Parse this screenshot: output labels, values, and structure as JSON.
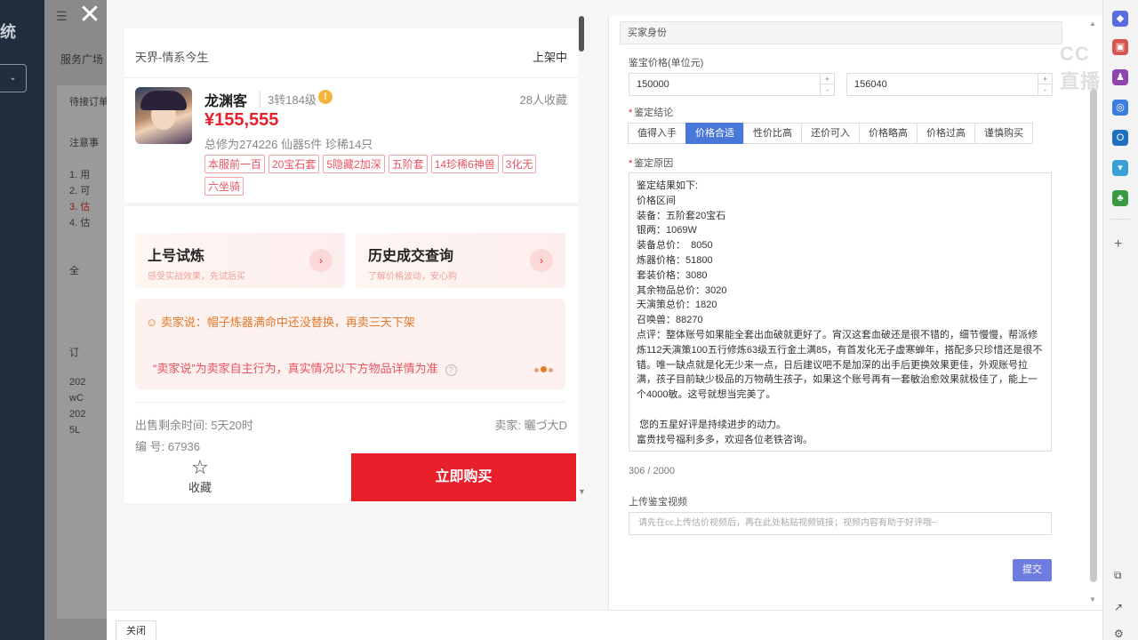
{
  "background": {
    "brand_fragment": "统",
    "select_arrow": "⌄",
    "nav_title": "服务广场",
    "card_lines": [
      "待接订单",
      "注意事",
      "1. 用",
      "2. 可",
      "3. 估",
      "4. 估",
      "全",
      "订",
      "202",
      "wC",
      "202",
      "5L"
    ]
  },
  "preview": {
    "server": "天界-情系今生",
    "status": "上架中",
    "role_name": "龙渊客",
    "role_level": "3转184级",
    "favorites": "28人收藏",
    "price": "¥155,555",
    "stats": "总修为274226  仙器5件  珍稀14只",
    "tags": [
      "本服前一百",
      "20宝石套",
      "5隐藏2加深",
      "五阶套",
      "14珍稀6神兽",
      "3化无",
      "六坐骑"
    ],
    "card1": {
      "title": "上号试炼",
      "sub": "感受实战效果，先试后买"
    },
    "card2": {
      "title": "历史成交查询",
      "sub": "了解价格波动，安心购"
    },
    "seller_says": "卖家说：帽子炼器满命中还没替换，再卖三天下架",
    "seller_note": "“卖家说”为卖家自主行为，真实情况以下方物品详情为准",
    "remaining": "出售剩余时间: 5天20时",
    "seller": "卖家: 曬づ大D",
    "code": "编 号: 67936",
    "favorite_label": "收藏",
    "buy_label": "立即购买"
  },
  "form": {
    "section_title": "买家身份",
    "price_label": "鉴宝价格(单位元)",
    "price_min": "150000",
    "price_max": "156040",
    "conclusion_label": "鉴定结论",
    "conclusion_options": [
      "值得入手",
      "价格合适",
      "性价比高",
      "还价可入",
      "价格略高",
      "价格过高",
      "谨慎购买"
    ],
    "conclusion_selected": "价格合适",
    "reason_label": "鉴定原因",
    "reason_text": "鉴定结果如下:\n价格区间\n装备：五阶套20宝石\n银两：1069W\n装备总价：  8050\n炼器价格：51800\n套装价格：3080\n其余物品总价：3020\n天演策总价：1820\n召唤兽：88270\n点评：整体账号如果能全套出血破就更好了。宵汉这套血破还是很不错的，细节慢慢，帮派修炼112天演策100五行修炼63级五行金土满85，有首发化无子虚寒蝉年，搭配多只珍惜还是很不错。唯一缺点就是化无少来一点，日后建议吧不是加深的出手后更换效果更佳，外观账号拉满，孩子目前缺少极品的万物萌生孩子，如果这个账号再有一套敏治愈效果就极佳了，能上一个4000敏。这号就想当完美了。\n\n 您的五星好评是持续进步的动力。\n富贵找号福利多多，欢迎各位老铁咨询。",
    "counter": "306 / 2000",
    "video_label": "上传鉴宝视频",
    "video_placeholder": "请先在cc上传估价视频后，再在此处粘贴视频链接；视频内容有助于好评哦~",
    "submit_label": "提交"
  },
  "footer": {
    "close_label": "关闭"
  },
  "watermark": "CC直播"
}
